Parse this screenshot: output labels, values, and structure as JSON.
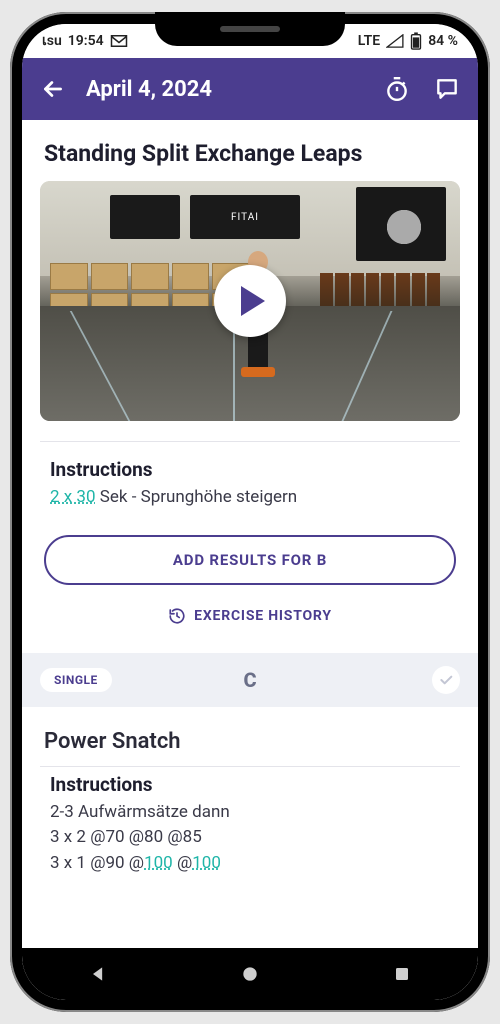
{
  "statusbar": {
    "carrier_prefix": "เsu",
    "time": "19:54",
    "network_label": "LTE",
    "battery_pct": "84 %"
  },
  "appbar": {
    "date_title": "April 4, 2024"
  },
  "exercise1": {
    "title": "Standing Split Exchange Leaps",
    "video_banner_text": "FITAI",
    "instructions_heading": "Instructions",
    "sets_reps_link": "2 x 30",
    "sets_reps_rest": " Sek - Sprunghöhe steigern",
    "add_results_label": "ADD RESULTS FOR B",
    "history_label": "EXERCISE HISTORY"
  },
  "sectionC": {
    "chip_label": "SINGLE",
    "letter": "C"
  },
  "exercise2": {
    "title": "Power Snatch",
    "instructions_heading": "Instructions",
    "line1": "2-3 Aufwärmsätze dann",
    "line2": "3 x 2 @70 @80 @85",
    "line3_prefix": "3 x 1 @90 @",
    "line3_link1": "100",
    "line3_mid": " @",
    "line3_link2": "100"
  },
  "colors": {
    "primary": "#4b3d8f",
    "accent_link": "#1fb5a8"
  }
}
